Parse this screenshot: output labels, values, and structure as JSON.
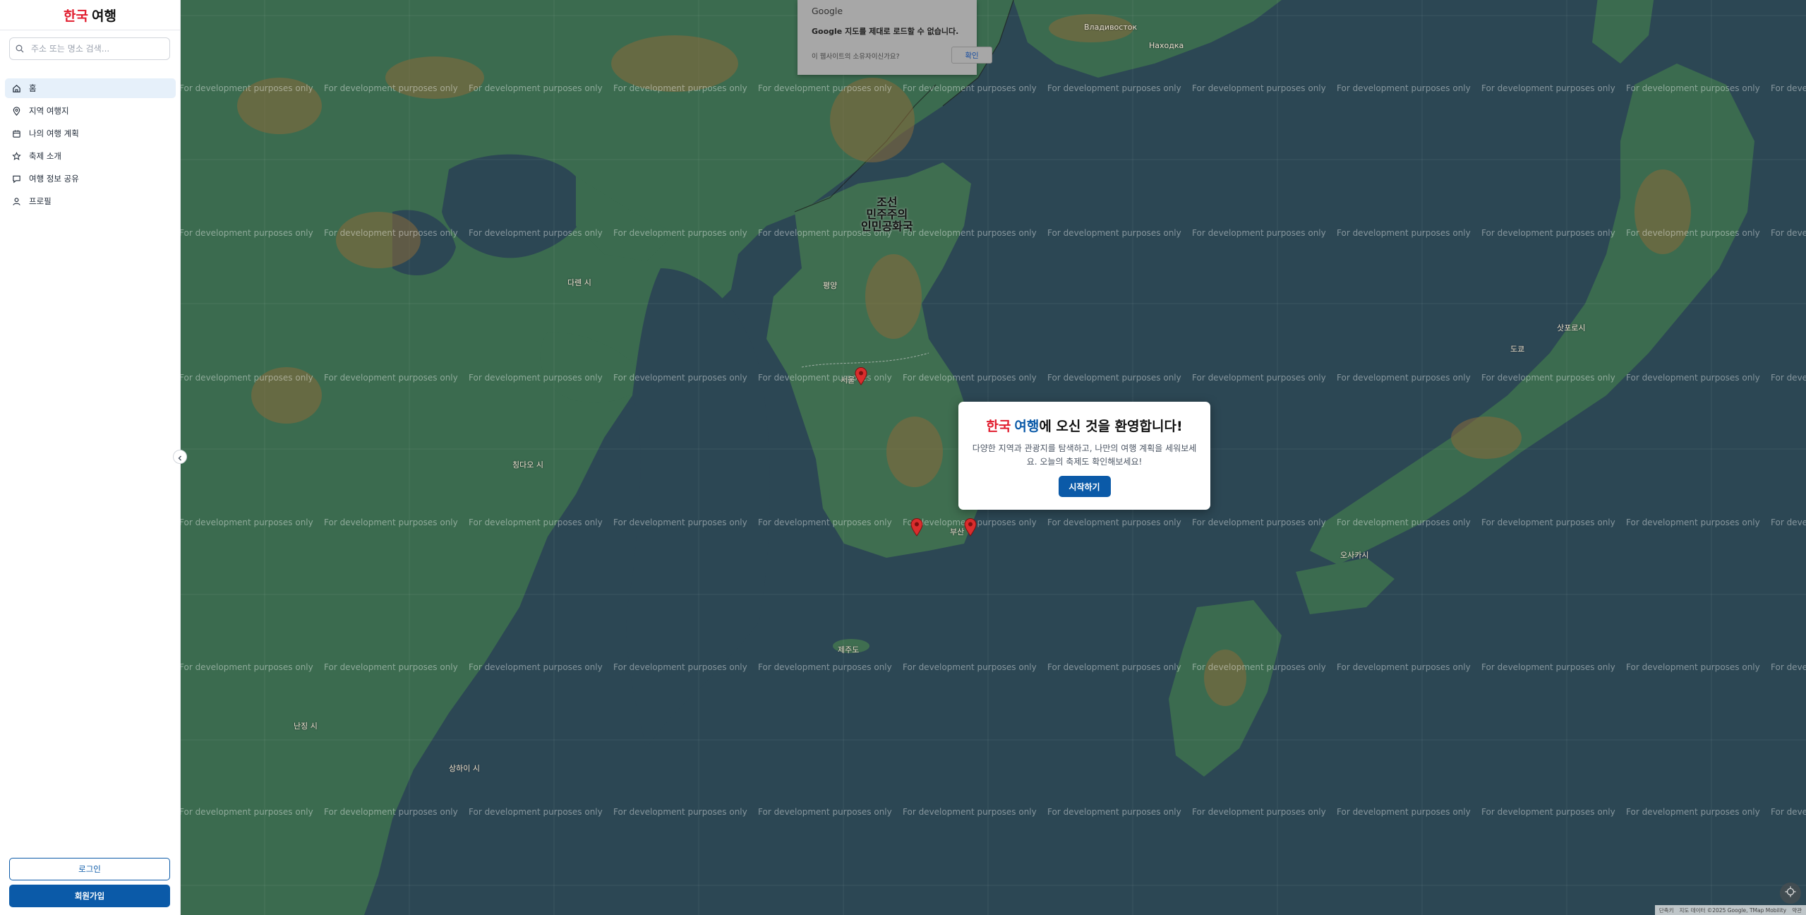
{
  "brand": {
    "korea": "한국",
    "travel": "여행"
  },
  "search": {
    "placeholder": "주소 또는 명소 검색..."
  },
  "nav": {
    "items": [
      {
        "label": "홈",
        "icon": "home-icon"
      },
      {
        "label": "지역 여행지",
        "icon": "map-pin-icon"
      },
      {
        "label": "나의 여행 계획",
        "icon": "calendar-plan-icon"
      },
      {
        "label": "축제 소개",
        "icon": "star-icon"
      },
      {
        "label": "여행 정보 공유",
        "icon": "message-icon"
      },
      {
        "label": "프로필",
        "icon": "user-icon"
      }
    ]
  },
  "auth": {
    "login": "로그인",
    "signup": "회원가입"
  },
  "map": {
    "watermark": "For development purposes only",
    "places": {
      "dprk": [
        "조선",
        "민주주의",
        "인민공화국"
      ],
      "vladivostok": "Владивосток",
      "nakhodka": "Находка",
      "dalian": "다롄 시",
      "seoul": "서울",
      "busan": "부산",
      "tokyo": "도쿄",
      "osaka": "오사카시",
      "jeju": "제주도",
      "pyongyang": "평양",
      "sapporo": "삿포로시",
      "shanghai": "상하이 시",
      "nanjing": "난징 시",
      "qingdao": "칭다오 시"
    },
    "attribution": [
      "단축키",
      "지도 데이터 ©2025 Google, TMap Mobility",
      "약관"
    ]
  },
  "google_dialog": {
    "brand": "Google",
    "message": "Google 지도를 제대로 로드할 수 없습니다.",
    "question": "이 웹사이트의 소유자이신가요?",
    "ok": "확인"
  },
  "welcome": {
    "title_korea": "한국",
    "title_travel": "여행",
    "title_rest": "에 오신 것을 환영합니다!",
    "description": "다양한 지역과 관광지를 탐색하고, 나만의 여행 계획을 세워보세요. 오늘의 축제도 확인해보세요!",
    "start": "시작하기"
  },
  "colors": {
    "accent": "#0b5aa8",
    "brand_red": "#e11d2e",
    "sea": "#2c4754",
    "land": "#3b6b4f",
    "pin": "#d92d2d"
  }
}
